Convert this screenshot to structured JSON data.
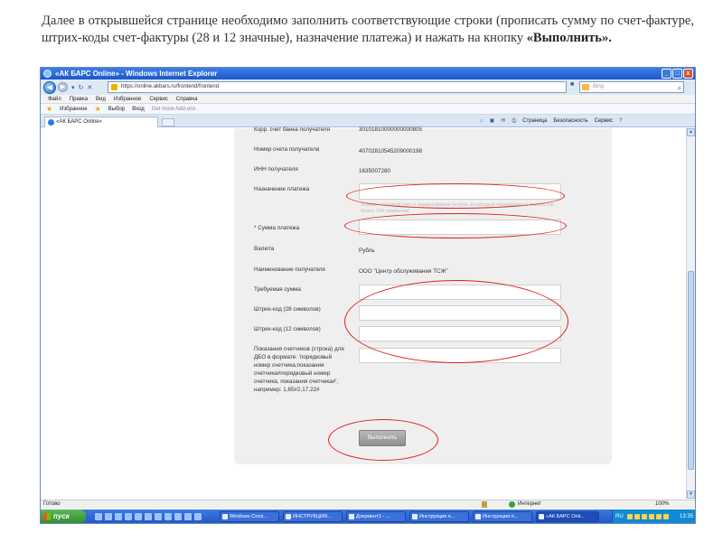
{
  "caption": {
    "text": "Далее в открывшейся странице необходимо заполнить соответствующие строки (прописать сумму по счет-фактуре, штрих-коды счет-фактуры (28 и 12 значные), назначение платежа) и нажать на кнопку",
    "bold": "«Выполнить»."
  },
  "window": {
    "title": "«АК БАРС Online» - Windows Internet Explorer",
    "address": "https://online.akbars.ru/frontend/frontend",
    "search_placeholder": "Bing"
  },
  "menu": [
    "Файл",
    "Правка",
    "Вид",
    "Избранное",
    "Сервис",
    "Справка"
  ],
  "favorites": {
    "label": "Избранное",
    "items": [
      "Выбор",
      "Вход",
      "Get more Add-ons"
    ]
  },
  "tab": {
    "label": "«АК БАРС Online»"
  },
  "commands": [
    "Страница",
    "Безопасность",
    "Сервис"
  ],
  "form": {
    "top_cut_label": "Корр. счет банка получателя",
    "top_cut_value": "30101810000000000805",
    "recipient_account_label": "Номер счета получателя",
    "recipient_account_value": "40702810545209000198",
    "inn_label": "ИНН получателя",
    "inn_value": "1635007280",
    "purpose_label": "Назначение платежа",
    "purpose_hint": "Укажите лицевой счет и наименование услуги, за которую производится оплата (не более 140 символов)",
    "amount_label": "* Сумма платежа",
    "currency_label": "Валюта",
    "currency_value": "Рубль",
    "recipient_name_label": "Наименование получателя",
    "recipient_name_value": "ООО \"Центр обслуживания ТСЖ\"",
    "required_sum_label": "Требуемая сумма",
    "barcode28_label": "Штрих-код (28 символов)",
    "barcode12_label": "Штрих-код (12 символов)",
    "meters_label": "Показания счетчиков (строка) для ДБО в формате: 'порядковый номер счетчика,показания счетчика#порядковый номер счетчика, показания счетчика#', например: 1,65#2,17.22#",
    "submit_label": "Выполнить"
  },
  "status": {
    "left": "Готово",
    "zone": "Интернет",
    "zoom": "100%"
  },
  "taskbar": {
    "start": "пуск",
    "tasks": [
      "Windows Cons...",
      "ИНСТРУКЦИЯ...",
      "Документ1 - ...",
      "Инструкция п...",
      "Инструкция п...",
      "«АК БАРС Onli..."
    ],
    "lang": "RU",
    "clock": "13:35"
  },
  "colors": {
    "annotation": "#e02020",
    "titlebar": "#1b57c9",
    "panel": "#efefef"
  }
}
